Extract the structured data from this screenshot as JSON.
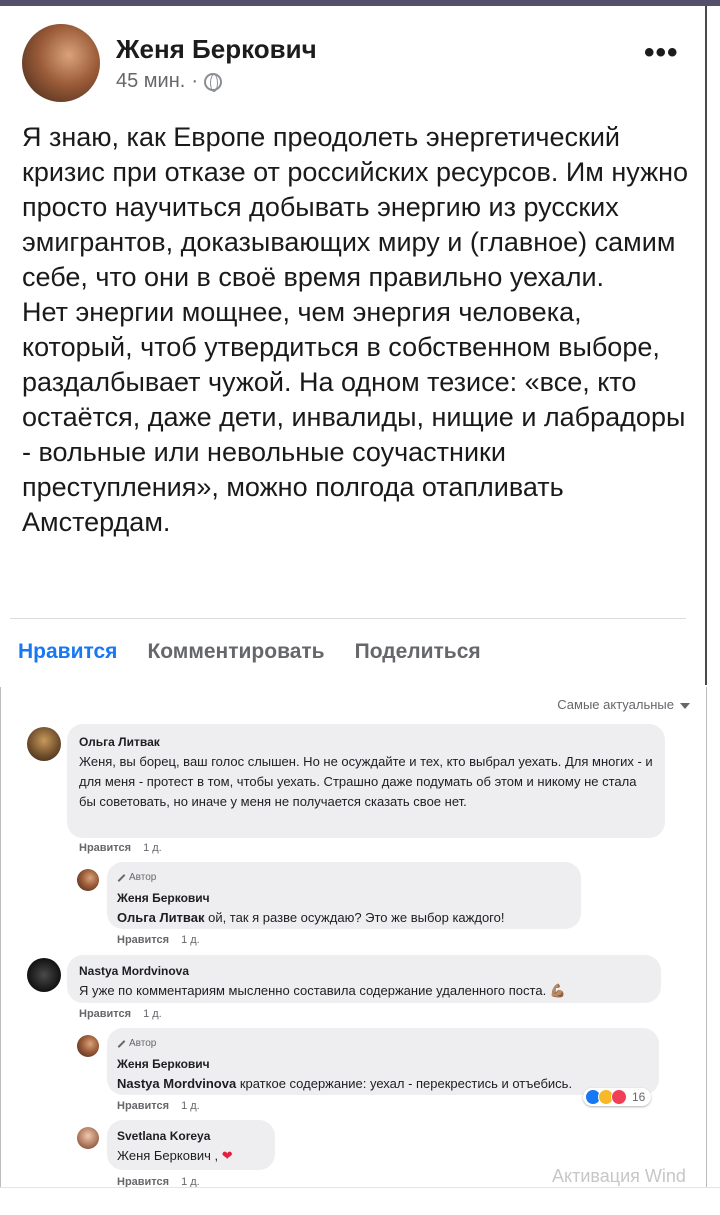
{
  "post": {
    "author": "Женя Беркович",
    "time": "45 мин.",
    "separator": "·",
    "more": "•••",
    "paragraph1": "Я знаю, как Европе преодолеть энергетический кризис при отказе от российских ресурсов. Им нужно просто научиться добывать энергию из русских эмигрантов, доказывающих миру и (главное) самим себе, что они в своё время правильно уехали.",
    "paragraph2": "Нет энергии мощнее, чем энергия человека, который, чтоб утвердиться в собственном выборе, раздалбывает чужой. На одном тезисе: «все, кто остаётся, даже дети, инвалиды, нищие и лабрадоры - вольные или невольные соучастники преступления», можно полгода отапливать Амстердам."
  },
  "actions": {
    "like": "Нравится",
    "comment": "Комментировать",
    "share": "Поделиться"
  },
  "comments": {
    "sort_label": "Самые актуальные",
    "items": [
      {
        "name": "Ольга Литвак",
        "text": "Женя, вы борец, ваш голос слышен. Но не осуждайте и тех, кто выбрал уехать. Для многих - и для меня - протест в том, чтобы уехать. Страшно даже подумать об этом и никому не стала бы советовать, но иначе у меня не получается сказать свое нет.",
        "like": "Нравится",
        "age": "1 д."
      },
      {
        "badge": "Автор",
        "name": "Женя Беркович",
        "mention": "Ольга Литвак",
        "text": " ой, так я разве осуждаю? Это же выбор каждого!",
        "like": "Нравится",
        "age": "1 д."
      },
      {
        "name": "Nastya Mordvinova",
        "text": "Я уже по комментариям мысленно составила содержание удаленного поста.",
        "emoji": "💪🏽",
        "like": "Нравится",
        "age": "1 д."
      },
      {
        "badge": "Автор",
        "name": "Женя Беркович",
        "mention": "Nastya Mordvinova",
        "text": " краткое содержание: уехал - перекрестись и отъебись.",
        "reactions_count": "16",
        "like": "Нравится",
        "age": "1 д."
      },
      {
        "name": "Svetlana Koreya",
        "mention": "Женя Беркович",
        "text": " , ",
        "heart": "❤",
        "like": "Нравится",
        "age": "1 д."
      }
    ]
  },
  "watermark": "Активация Wind",
  "colors": {
    "accent": "#1877f2",
    "muted": "#65676b",
    "bubble": "#eeeef0"
  }
}
